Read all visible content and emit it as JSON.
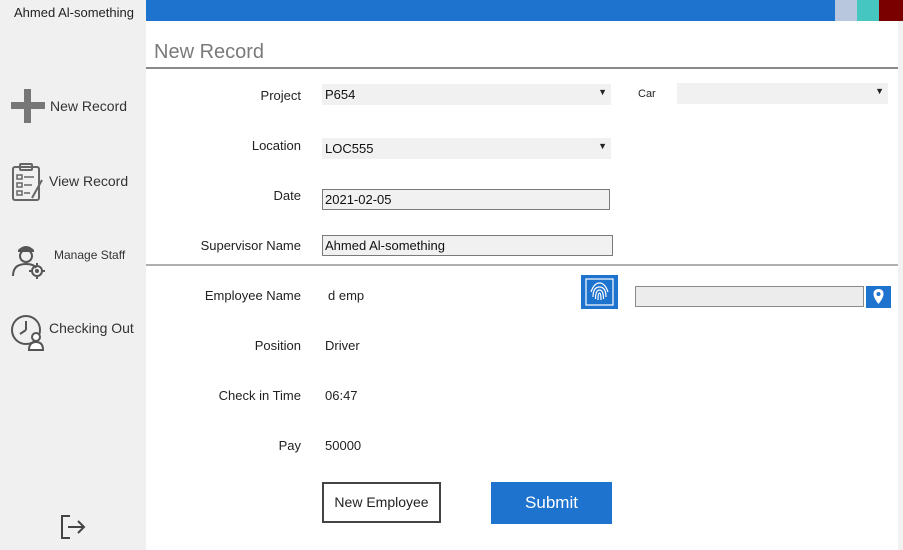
{
  "user": {
    "name": "Ahmed Al-something"
  },
  "sidebar": {
    "items": [
      {
        "label": "New Record",
        "icon": "plus-icon"
      },
      {
        "label": "View Record",
        "icon": "clipboard-checklist-icon"
      },
      {
        "label": "Manage Staff",
        "icon": "staff-gear-icon"
      },
      {
        "label": "Checking Out",
        "icon": "clock-user-icon"
      }
    ],
    "logout_icon": "logout-icon"
  },
  "page": {
    "title": "New Record"
  },
  "form": {
    "project": {
      "label": "Project",
      "value": "P654"
    },
    "car": {
      "label": "Car",
      "value": ""
    },
    "location": {
      "label": "Location",
      "value": "LOC555"
    },
    "date": {
      "label": "Date",
      "value": "2021-02-05"
    },
    "supervisor": {
      "label": "Supervisor Name",
      "value": "Ahmed Al-something"
    },
    "employee": {
      "label": "Employee Name",
      "value": "d emp"
    },
    "position": {
      "label": "Position",
      "value": "Driver"
    },
    "checkin": {
      "label": "Check in Time",
      "value": "06:47"
    },
    "pay": {
      "label": "Pay",
      "value": "50000"
    },
    "gps_location": {
      "value": ""
    }
  },
  "buttons": {
    "new_employee": "New Employee",
    "submit": "Submit"
  },
  "colors": {
    "accent": "#1e73cf",
    "sidebar_bg": "#f0f0f0",
    "field_bg": "#f1f1f1"
  }
}
